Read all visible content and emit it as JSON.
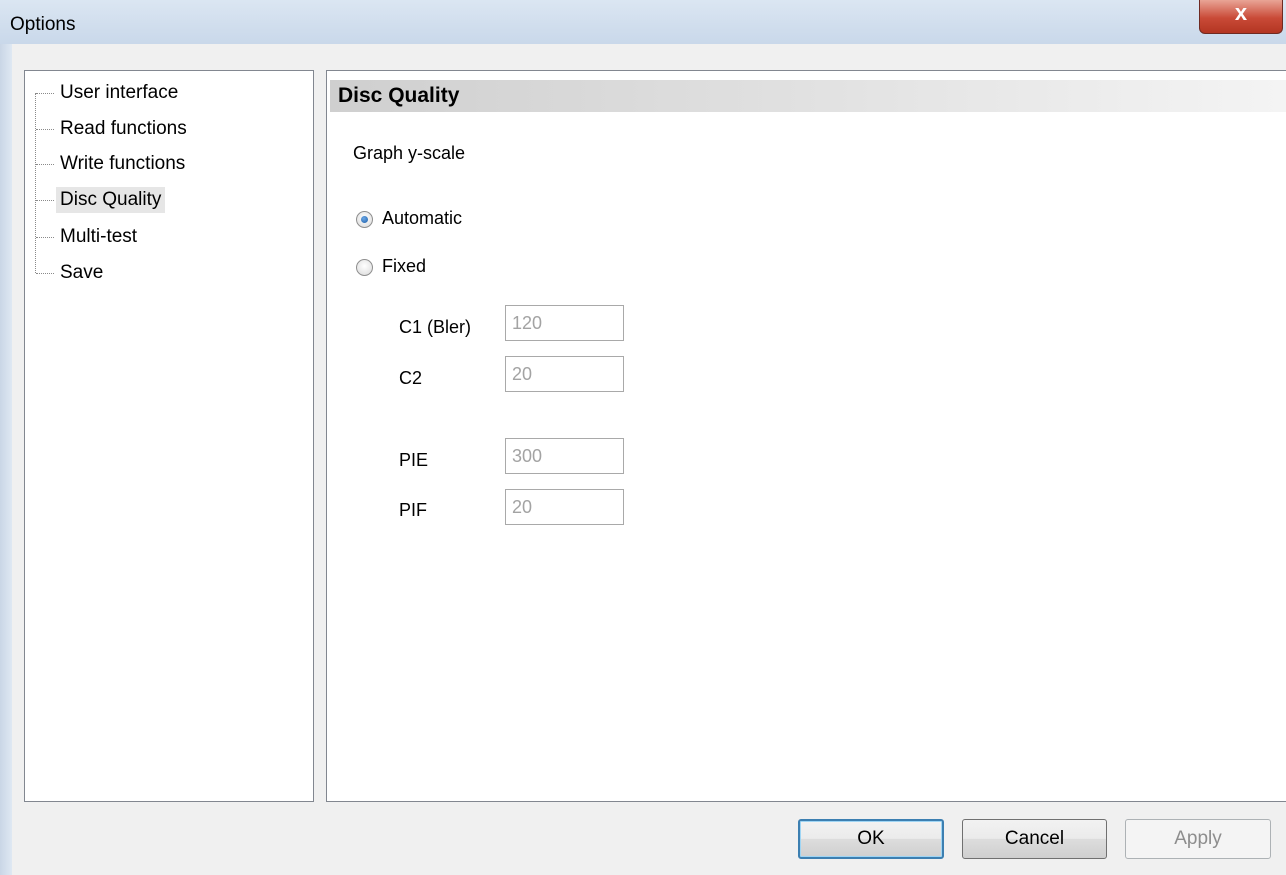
{
  "window": {
    "title": "Options",
    "close_glyph": "x"
  },
  "tree": {
    "items": [
      {
        "label": "User interface"
      },
      {
        "label": "Read functions"
      },
      {
        "label": "Write functions"
      },
      {
        "label": "Disc Quality",
        "selected": true
      },
      {
        "label": "Multi-test"
      },
      {
        "label": "Save"
      }
    ]
  },
  "panel": {
    "title": "Disc Quality",
    "group_label": "Graph y-scale",
    "radio_automatic": "Automatic",
    "radio_fixed": "Fixed",
    "selected_mode": "Automatic",
    "fields": [
      {
        "label": "C1 (Bler)",
        "value": "120"
      },
      {
        "label": "C2",
        "value": "20"
      },
      {
        "label": "PIE",
        "value": "300"
      },
      {
        "label": "PIF",
        "value": "20"
      }
    ]
  },
  "buttons": {
    "ok": "OK",
    "cancel": "Cancel",
    "apply": "Apply"
  }
}
